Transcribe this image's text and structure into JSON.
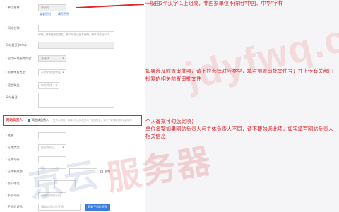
{
  "form": {
    "rows": [
      {
        "label": "* 单位名称:",
        "value": "请填写",
        "state": "disabled"
      },
      {
        "label": "* 网站名称:",
        "value": ""
      },
      {
        "label": "网站首页 (URL):",
        "value": "",
        "state": "disabled"
      },
      {
        "label": "* 应用网站服务内容:",
        "value": "请选择",
        "state": "select"
      },
      {
        "label": "* 前置审批类型:",
        "value": "不涉及前置审批",
        "state": "select"
      },
      {
        "label": "* 语言种类:",
        "value": "中文简体",
        "state": "select"
      },
      {
        "label": "网站备注:",
        "value": ""
      }
    ],
    "name_links": [
      "查看规则",
      "填写示例"
    ],
    "domain_hint": "请输入您要备案的域名，多个域名以回车分隔，最多可添加20个",
    "lower_rows": [
      {
        "label": "* 姓名:",
        "value": ""
      },
      {
        "label": "* 证件类型:",
        "value": "居民身份证",
        "state": "select"
      },
      {
        "label": "* 证件号码:",
        "value": ""
      },
      {
        "label": "* 证件有效期:",
        "value": ""
      },
      {
        "label": "* 办公电话:",
        "value": ""
      },
      {
        "label": "* 手机号码:",
        "value": "请输入手机号码"
      },
      {
        "label": "* 手机验证码:",
        "value": "请输入短信验证码"
      }
    ],
    "longterm_label": "长期",
    "code_button": "获取手机验证码"
  },
  "section": {
    "title": "网站负责人",
    "checkbox_label": "同主体负责人",
    "note": "负责人说明，请填写与主体负责人一致的信息，如不一致请取消勾选并填写"
  },
  "annotations": {
    "top": "一般由3个汉字以上组成，非国家单位不得用\"中国、中华\"字样",
    "middle": "如果涉及前置审批项，请下拉选择对应类型，填写前置审批文件号；并上传有关部门批复的相关前置审批文件",
    "bottom": "个人备案可勾选此项；\n单位备案如果网站负责人与主体负责人不同，请不要勾选此项，如实填写网站负责人相关信息"
  },
  "watermark": {
    "text_left": "京云",
    "text_mid": "服务器",
    "text_right": "jdyfwq.com",
    "color": "#e0262b"
  }
}
